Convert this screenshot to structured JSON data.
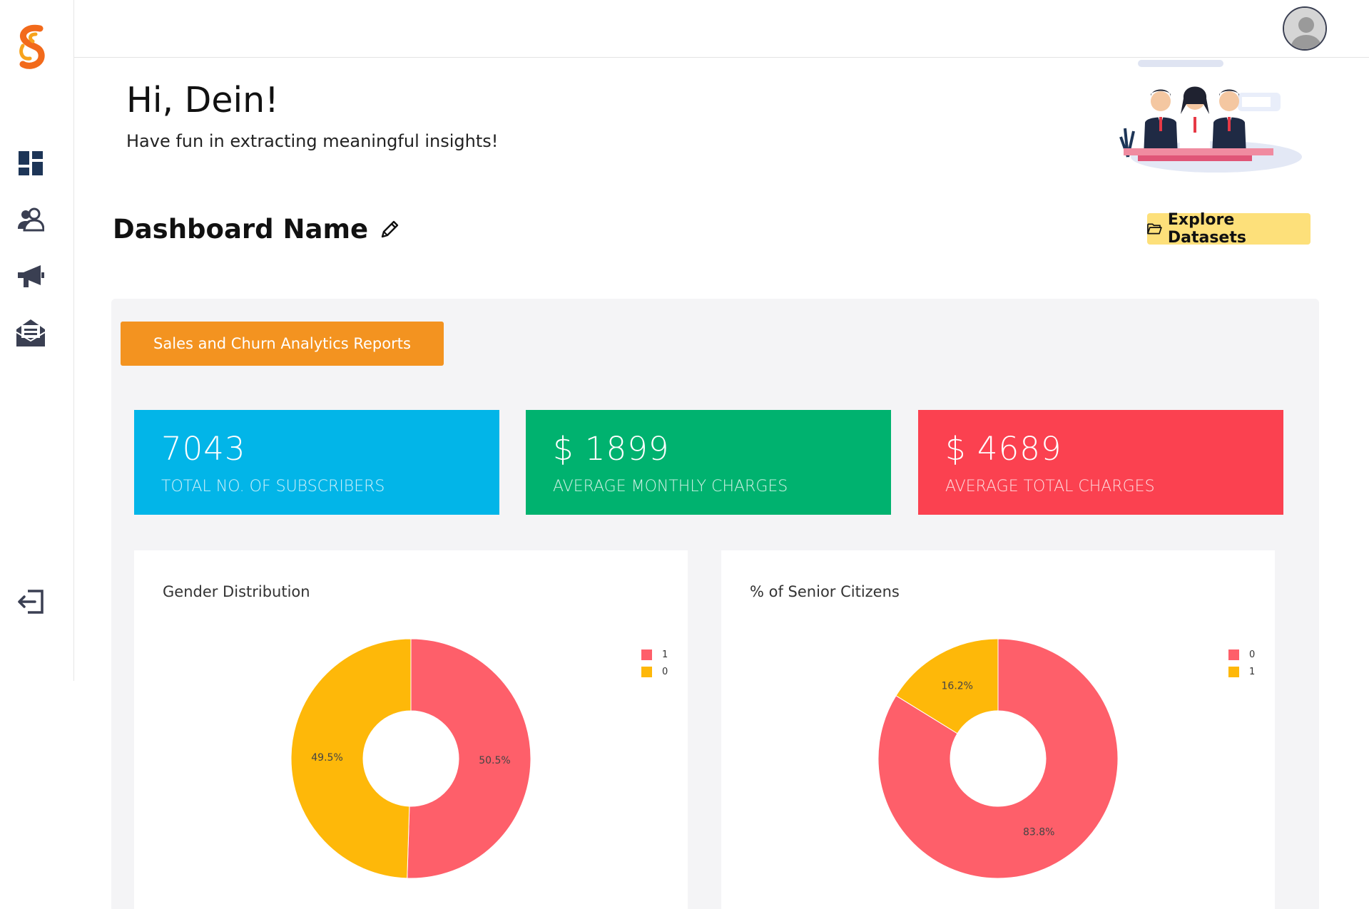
{
  "app": {
    "logo_icon": "brand-logo-icon"
  },
  "sidebar": {
    "items": [
      {
        "name": "dashboard",
        "icon": "dashboard-grid-icon"
      },
      {
        "name": "customers",
        "icon": "users-icon"
      },
      {
        "name": "campaigns",
        "icon": "megaphone-icon"
      },
      {
        "name": "messages",
        "icon": "mail-open-icon"
      }
    ],
    "logout_icon": "logout-icon"
  },
  "header": {
    "greeting": "Hi, Dein!",
    "subtitle": "Have fun in extracting meaningful insights!"
  },
  "dashboard": {
    "name": "Dashboard Name",
    "explore_label": "Explore Datasets",
    "report_label": "Sales and Churn Analytics Reports"
  },
  "kpis": [
    {
      "value": "7043",
      "label": "TOTAL NO. OF SUBSCRIBERS",
      "color": "#02b5e8"
    },
    {
      "value": "$ 1899",
      "label": "AVERAGE MONTHLY CHARGES",
      "color": "#00b26f"
    },
    {
      "value": "$ 4689",
      "label": "AVERAGE TOTAL CHARGES",
      "color": "#fb4150"
    }
  ],
  "colors": {
    "red": "#fe5f6a",
    "yellow": "#feb809",
    "accent_orange": "#f39320",
    "explore_yellow": "#fde07a"
  },
  "chart_data": [
    {
      "type": "pie",
      "title": "Gender Distribution",
      "hole": true,
      "categories": [
        "1",
        "0"
      ],
      "values": [
        50.5,
        49.5
      ],
      "labels": [
        "50.5%",
        "49.5%"
      ],
      "colors": [
        "#fe5f6a",
        "#feb809"
      ],
      "legend": "top-right"
    },
    {
      "type": "pie",
      "title": "% of Senior Citizens",
      "hole": true,
      "categories": [
        "0",
        "1"
      ],
      "values": [
        83.8,
        16.2
      ],
      "labels": [
        "83.8%",
        "16.2%"
      ],
      "colors": [
        "#fe5f6a",
        "#feb809"
      ],
      "legend": "top-right"
    }
  ]
}
